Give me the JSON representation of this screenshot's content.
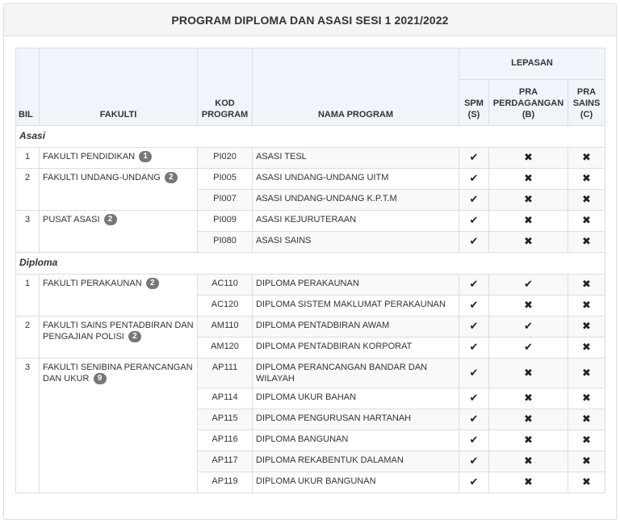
{
  "title": "PROGRAM DIPLOMA DAN ASASI SESI 1 2021/2022",
  "headers": {
    "bil": "BIL",
    "fakulti": "FAKULTI",
    "kod": "KOD PROGRAM",
    "nama": "NAMA PROGRAM",
    "lepasan": "LEPASAN",
    "spm": "SPM (S)",
    "pra_perdagangan": "PRA PERDAGANGAN (B)",
    "pra_sains": "PRA SAINS (C)"
  },
  "icons": {
    "yes": "check-icon",
    "no": "cross-icon"
  },
  "symbols": {
    "yes": "✔",
    "no": "✖"
  },
  "sections": [
    {
      "name": "Asasi",
      "faculties": [
        {
          "bil": "1",
          "name": "FAKULTI PENDIDIKAN",
          "count": "1",
          "programs": [
            {
              "kod": "PI020",
              "nama": "ASASI TESL",
              "s": true,
              "b": false,
              "c": false
            }
          ]
        },
        {
          "bil": "2",
          "name": "FAKULTI UNDANG-UNDANG",
          "count": "2",
          "programs": [
            {
              "kod": "PI005",
              "nama": "ASASI UNDANG-UNDANG UITM",
              "s": true,
              "b": false,
              "c": false
            },
            {
              "kod": "PI007",
              "nama": "ASASI UNDANG-UNDANG K.P.T.M",
              "s": true,
              "b": false,
              "c": false
            }
          ]
        },
        {
          "bil": "3",
          "name": "PUSAT ASASI",
          "count": "2",
          "programs": [
            {
              "kod": "PI009",
              "nama": "ASASI KEJURUTERAAN",
              "s": true,
              "b": false,
              "c": false
            },
            {
              "kod": "PI080",
              "nama": "ASASI SAINS",
              "s": true,
              "b": false,
              "c": false
            }
          ]
        }
      ]
    },
    {
      "name": "Diploma",
      "faculties": [
        {
          "bil": "1",
          "name": "FAKULTI PERAKAUNAN",
          "count": "2",
          "programs": [
            {
              "kod": "AC110",
              "nama": "DIPLOMA PERAKAUNAN",
              "s": true,
              "b": true,
              "c": false
            },
            {
              "kod": "AC120",
              "nama": "DIPLOMA SISTEM MAKLUMAT PERAKAUNAN",
              "s": true,
              "b": false,
              "c": false
            }
          ]
        },
        {
          "bil": "2",
          "name": "FAKULTI SAINS PENTADBIRAN DAN PENGAJIAN POLISI",
          "count": "2",
          "programs": [
            {
              "kod": "AM110",
              "nama": "DIPLOMA PENTADBIRAN AWAM",
              "s": true,
              "b": true,
              "c": false
            },
            {
              "kod": "AM120",
              "nama": "DIPLOMA PENTADBIRAN KORPORAT",
              "s": true,
              "b": true,
              "c": false
            }
          ]
        },
        {
          "bil": "3",
          "name": "FAKULTI SENIBINA PERANCANGAN DAN UKUR",
          "count": "9",
          "programs": [
            {
              "kod": "AP111",
              "nama": "DIPLOMA PERANCANGAN BANDAR DAN WILAYAH",
              "s": true,
              "b": false,
              "c": false
            },
            {
              "kod": "AP114",
              "nama": "DIPLOMA UKUR BAHAN",
              "s": true,
              "b": false,
              "c": false
            },
            {
              "kod": "AP115",
              "nama": "DIPLOMA PENGURUSAN HARTANAH",
              "s": true,
              "b": false,
              "c": false
            },
            {
              "kod": "AP116",
              "nama": "DIPLOMA BANGUNAN",
              "s": true,
              "b": false,
              "c": false
            },
            {
              "kod": "AP117",
              "nama": "DIPLOMA REKABENTUK DALAMAN",
              "s": true,
              "b": false,
              "c": false
            },
            {
              "kod": "AP119",
              "nama": "DIPLOMA UKUR BANGUNAN",
              "s": true,
              "b": false,
              "c": false
            }
          ]
        }
      ]
    }
  ]
}
